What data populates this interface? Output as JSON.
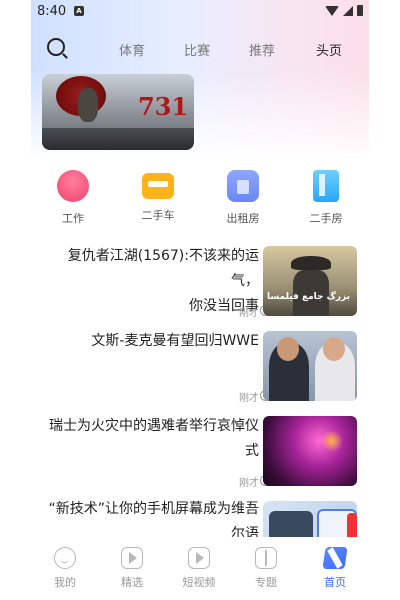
{
  "status": {
    "time": "8:40",
    "notif_letter": "A"
  },
  "topnav": {
    "tabs": [
      {
        "label": "体育"
      },
      {
        "label": "比赛"
      },
      {
        "label": "推荐"
      },
      {
        "label": "头页"
      }
    ]
  },
  "banner": {
    "text": "731"
  },
  "quick_links": [
    {
      "label": "工作",
      "icon": "work-icon"
    },
    {
      "label": "二手车",
      "icon": "used-car-icon"
    },
    {
      "label": "出租房",
      "icon": "rental-house-icon"
    },
    {
      "label": "二手房",
      "icon": "second-hand-house-icon"
    }
  ],
  "news": [
    {
      "title_line1": "复仇者江湖(1567):不该来的运气，",
      "title_line2": "你没当回事",
      "time": "刚才",
      "thumb_text": "بزرگ جامع فیلمسا"
    },
    {
      "title_line1": "文斯-麦克曼有望回归WWE",
      "title_line2": "",
      "time": "刚才"
    },
    {
      "title_line1": "瑞士为火灾中的遇难者举行哀悼仪",
      "title_line2": "式",
      "time": "刚才"
    },
    {
      "title_line1": "“新技术”让你的手机屏幕成为维吾",
      "title_line2": "尔语",
      "time": ""
    }
  ],
  "bottomnav": {
    "items": [
      {
        "label": "我的"
      },
      {
        "label": "精选"
      },
      {
        "label": "短视频"
      },
      {
        "label": "专题"
      },
      {
        "label": "首页"
      }
    ]
  },
  "colors": {
    "accent": "#3b6cf6"
  }
}
